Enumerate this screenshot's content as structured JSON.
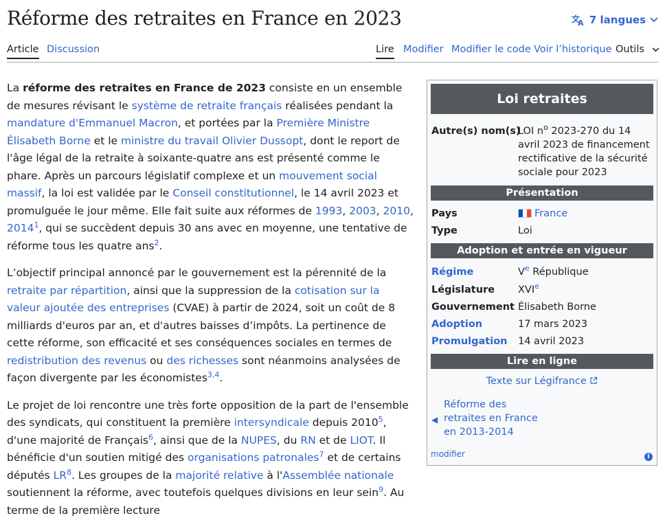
{
  "header": {
    "title": "Réforme des retraites en France en 2023",
    "languages_label": "7 langues"
  },
  "tabs": {
    "article": "Article",
    "discussion": "Discussion",
    "read": "Lire",
    "edit": "Modifier",
    "edit_source": "Modifier le code",
    "history": "Voir l’historique",
    "tools": "Outils"
  },
  "article": {
    "p1": [
      {
        "t": "La "
      },
      {
        "t": "réforme des retraites en France de 2023",
        "b": true
      },
      {
        "t": " consiste en un ensemble de mesures révisant le "
      },
      {
        "t": "système de retraite français",
        "l": true
      },
      {
        "t": " réalisées pendant la "
      },
      {
        "t": "mandature d'Emmanuel Macron",
        "l": true
      },
      {
        "t": ", et portées par la "
      },
      {
        "t": "Première Ministre Élisabeth Borne",
        "l": true
      },
      {
        "t": " et le "
      },
      {
        "t": "ministre du travail Olivier Dussopt",
        "l": true
      },
      {
        "t": ", dont le report de l'âge légal de la retraite à soixante-quatre ans est présenté comme le phare. Après un parcours législatif complexe et un "
      },
      {
        "t": "mouvement social massif",
        "l": true
      },
      {
        "t": ", la loi est validée par le "
      },
      {
        "t": "Conseil constitutionnel",
        "l": true
      },
      {
        "t": ", le 14 avril 2023 et promulguée le jour même. Elle fait suite aux réformes de "
      },
      {
        "t": "1993",
        "l": true
      },
      {
        "t": ", "
      },
      {
        "t": "2003",
        "l": true
      },
      {
        "t": ", "
      },
      {
        "t": "2010",
        "l": true
      },
      {
        "t": ", "
      },
      {
        "t": "2014",
        "l": true
      },
      {
        "t": "1",
        "s": true
      },
      {
        "t": ", qui se succèdent depuis 30 ans avec en moyenne, une tentative de réforme tous les quatre ans"
      },
      {
        "t": "2",
        "s": true
      },
      {
        "t": "."
      }
    ],
    "p2": [
      {
        "t": "L’objectif principal annoncé par le gouvernement est la pérennité de la "
      },
      {
        "t": "retraite par répartition",
        "l": true
      },
      {
        "t": ", ainsi que la suppression de la "
      },
      {
        "t": "cotisation sur la valeur ajoutée des entreprises",
        "l": true
      },
      {
        "t": " (CVAE) à partir de 2024, soit un coût de 8 milliards d'euros par an, et d'autres baisses d’impôts. La pertinence de cette réforme, son efficacité et ses conséquences sociales en termes de "
      },
      {
        "t": "redistribution des revenus",
        "l": true
      },
      {
        "t": " ou "
      },
      {
        "t": "des richesses",
        "l": true
      },
      {
        "t": " sont néanmoins analysées de façon divergente par les économistes"
      },
      {
        "t": "3,4",
        "s": true
      },
      {
        "t": "."
      }
    ],
    "p3": [
      {
        "t": "Le projet de loi rencontre une très forte opposition de la part de l'ensemble des syndicats, qui constituent la première "
      },
      {
        "t": "intersyndicale",
        "l": true
      },
      {
        "t": " depuis 2010"
      },
      {
        "t": "5",
        "s": true
      },
      {
        "t": ", d'une majorité de Français"
      },
      {
        "t": "6",
        "s": true
      },
      {
        "t": ", ainsi que de la "
      },
      {
        "t": "NUPES",
        "l": true
      },
      {
        "t": ", du "
      },
      {
        "t": "RN",
        "l": true
      },
      {
        "t": " et de "
      },
      {
        "t": "LIOT",
        "l": true
      },
      {
        "t": ". Il bénéficie d'un soutien mitigé des "
      },
      {
        "t": "organisations patronales",
        "l": true
      },
      {
        "t": "7",
        "s": true
      },
      {
        "t": " et de certains députés "
      },
      {
        "t": "LR",
        "l": true
      },
      {
        "t": "8",
        "s": true
      },
      {
        "t": ". Les groupes de la "
      },
      {
        "t": "majorité relative",
        "l": true
      },
      {
        "t": " à l'"
      },
      {
        "t": "Assemblée nationale",
        "l": true
      },
      {
        "t": " soutiennent la réforme, avec toutefois quelques divisions en leur sein"
      },
      {
        "t": "9",
        "s": true
      },
      {
        "t": ". Au terme de la première lecture"
      }
    ]
  },
  "infobox": {
    "title": "Loi retraites",
    "other_names_label": "Autre(s) nom(s)",
    "other_names_pre": "LOI n",
    "other_names_sup": "o",
    "other_names_post": " 2023-270 du 14 avril 2023 de financement rectificative de la sécurité sociale pour 2023",
    "section_presentation": "Présentation",
    "country_label": "Pays",
    "country_value": "France",
    "type_label": "Type",
    "type_value": "Loi",
    "section_adoption": "Adoption et entrée en vigueur",
    "regime_label": "Régime",
    "regime_pre": "V",
    "regime_sup": "e",
    "regime_post": " République",
    "legislature_label": "Législature",
    "legislature_pre": "XVI",
    "legislature_sup": "e",
    "government_label": "Gouvernement",
    "government_value": "Élisabeth Borne",
    "adoption_label": "Adoption",
    "adoption_value": "17 mars 2023",
    "promulgation_label": "Promulgation",
    "promulgation_value": "14 avril 2023",
    "section_online": "Lire en ligne",
    "legifrance_link": "Texte sur Légifrance",
    "previous_reform": "Réforme des retraites en France en 2013-2014",
    "edit_link": "modifier"
  }
}
